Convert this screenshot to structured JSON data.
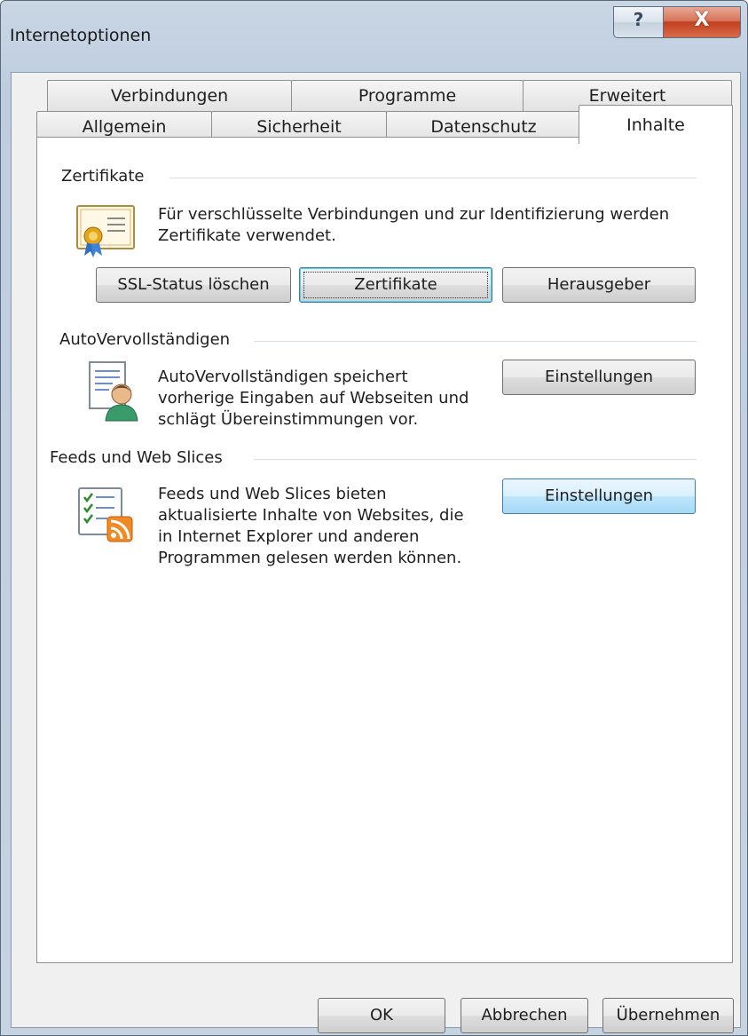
{
  "window": {
    "title": "Internetoptionen",
    "help_glyph": "?",
    "close_glyph": "X"
  },
  "tabs_row1": [
    "Verbindungen",
    "Programme",
    "Erweitert"
  ],
  "tabs_row2": [
    "Allgemein",
    "Sicherheit",
    "Datenschutz",
    "Inhalte"
  ],
  "active_tab": "Inhalte",
  "certificates": {
    "label": "Zertifikate",
    "description_lines": [
      "Für verschlüsselte Verbindungen und zur Identifizierung werden",
      "Zertifikate verwendet."
    ],
    "buttons": [
      "SSL-Status löschen",
      "Zertifikate",
      "Herausgeber"
    ],
    "icon": "certificate-icon"
  },
  "autocomplete": {
    "label": "AutoVervollständigen",
    "description_lines": [
      "AutoVervollständigen speichert",
      "vorherige Eingaben auf Webseiten und",
      "schlägt Übereinstimmungen vor."
    ],
    "button": "Einstellungen",
    "icon": "autocomplete-user-icon"
  },
  "feeds": {
    "label": "Feeds und Web Slices",
    "description_lines": [
      "Feeds und Web Slices bieten",
      "aktualisierte Inhalte von Websites, die",
      "in Internet Explorer und anderen",
      "Programmen gelesen werden können."
    ],
    "button": "Einstellungen",
    "icon": "rss-feed-icon"
  },
  "footer": {
    "ok": "OK",
    "cancel": "Abbrechen",
    "apply": "Übernehmen"
  },
  "colors": {
    "accent_focus": "#48d4f7",
    "hot_button": "#bee6fd",
    "close_red": "#c2401f"
  }
}
